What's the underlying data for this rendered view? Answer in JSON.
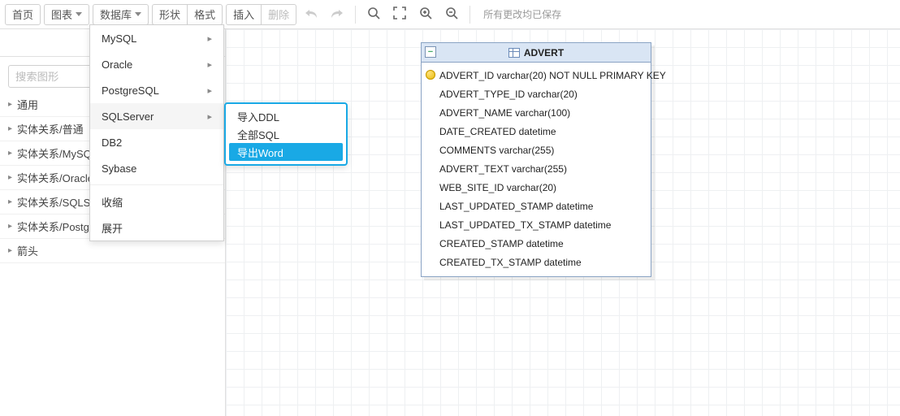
{
  "toolbar": {
    "home": "首页",
    "chart": "图表",
    "database": "数据库",
    "shape": "形状",
    "format": "格式",
    "insert": "插入",
    "delete": "删除",
    "save_status": "所有更改均已保存"
  },
  "sidebar": {
    "search_placeholder": "搜索图形",
    "groups": [
      "通用",
      "实体关系/普通",
      "实体关系/MySQL",
      "实体关系/Oracle",
      "实体关系/SQLServer",
      "实体关系/PostgreSQL",
      "箭头"
    ]
  },
  "db_menu": {
    "items": [
      {
        "label": "MySQL",
        "has_sub": true
      },
      {
        "label": "Oracle",
        "has_sub": true
      },
      {
        "label": "PostgreSQL",
        "has_sub": true
      },
      {
        "label": "SQLServer",
        "has_sub": true
      },
      {
        "label": "DB2",
        "has_sub": false
      },
      {
        "label": "Sybase",
        "has_sub": false
      }
    ],
    "extra": [
      "收缩",
      "展开"
    ]
  },
  "sub_menu": {
    "items": [
      "导入DDL",
      "全部SQL",
      "导出Word"
    ],
    "selected_index": 2
  },
  "entity": {
    "name": "ADVERT",
    "columns": [
      {
        "text": "ADVERT_ID varchar(20) NOT NULL PRIMARY KEY",
        "pk": true
      },
      {
        "text": "ADVERT_TYPE_ID varchar(20)",
        "pk": false
      },
      {
        "text": "ADVERT_NAME varchar(100)",
        "pk": false
      },
      {
        "text": "DATE_CREATED datetime",
        "pk": false
      },
      {
        "text": "COMMENTS varchar(255)",
        "pk": false
      },
      {
        "text": "ADVERT_TEXT varchar(255)",
        "pk": false
      },
      {
        "text": "WEB_SITE_ID varchar(20)",
        "pk": false
      },
      {
        "text": "LAST_UPDATED_STAMP datetime",
        "pk": false
      },
      {
        "text": "LAST_UPDATED_TX_STAMP datetime",
        "pk": false
      },
      {
        "text": "CREATED_STAMP datetime",
        "pk": false
      },
      {
        "text": "CREATED_TX_STAMP datetime",
        "pk": false
      }
    ]
  }
}
